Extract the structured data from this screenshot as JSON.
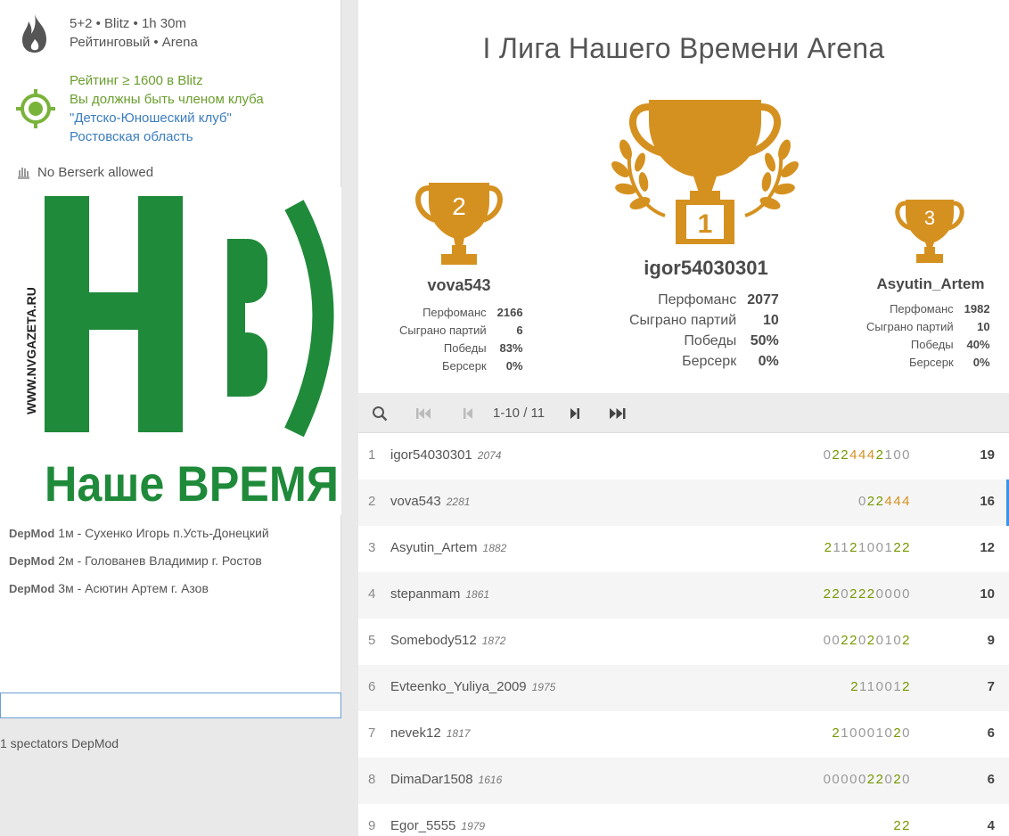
{
  "tournament": {
    "clock_line": "5+2 • Blitz • 1h 30m",
    "rated_line": "Рейтинговый • Arena",
    "conditions": {
      "rating": "Рейтинг ≥ 1600 в Blitz",
      "club_req": "Вы должны быть членом клуба",
      "club_name": "\"Детско-Юношеский клуб\"",
      "region": "Ростовская область"
    },
    "berserk": "No Berserk allowed"
  },
  "logo": {
    "site": "WWW.NVGAZETA.RU",
    "letters": "НВ",
    "name": "Наше ВРЕМЯ"
  },
  "chat": {
    "messages": [
      {
        "user": "DepMod",
        "text": "1м - Сухенко Игорь п.Усть-Донецкий"
      },
      {
        "user": "DepMod",
        "text": "2м - Голованев Владимир г. Ростов"
      },
      {
        "user": "DepMod",
        "text": "3м - Асютин Артем г. Азов"
      }
    ],
    "input_value": ""
  },
  "spectators": "1 spectators DepMod",
  "main": {
    "title": "I Лига Нашего Времени Arena",
    "podium": {
      "first": {
        "place": "1",
        "name": "igor54030301",
        "stats": [
          [
            "Перфоманс",
            "2077"
          ],
          [
            "Сыграно партий",
            "10"
          ],
          [
            "Победы",
            "50%"
          ],
          [
            "Берсерк",
            "0%"
          ]
        ]
      },
      "second": {
        "place": "2",
        "name": "vova543",
        "stats": [
          [
            "Перфоманс",
            "2166"
          ],
          [
            "Сыграно партий",
            "6"
          ],
          [
            "Победы",
            "83%"
          ],
          [
            "Берсерк",
            "0%"
          ]
        ]
      },
      "third": {
        "place": "3",
        "name": "Asyutin_Artem",
        "stats": [
          [
            "Перфоманс",
            "1982"
          ],
          [
            "Сыграно партий",
            "10"
          ],
          [
            "Победы",
            "40%"
          ],
          [
            "Берсерк",
            "0%"
          ]
        ]
      }
    },
    "pager": "1-10 / 11",
    "standings": [
      {
        "rank": "1",
        "name": "igor54030301",
        "rating": "2074",
        "sheet": "0224442100",
        "score": "19"
      },
      {
        "rank": "2",
        "name": "vova543",
        "rating": "2281",
        "sheet": "022444",
        "score": "16"
      },
      {
        "rank": "3",
        "name": "Asyutin_Artem",
        "rating": "1882",
        "sheet": "2112100122",
        "score": "12"
      },
      {
        "rank": "4",
        "name": "stepanmam",
        "rating": "1861",
        "sheet": "2202220000",
        "score": "10"
      },
      {
        "rank": "5",
        "name": "Somebody512",
        "rating": "1872",
        "sheet": "0022020102",
        "score": "9"
      },
      {
        "rank": "6",
        "name": "Evteenko_Yuliya_2009",
        "rating": "1975",
        "sheet": "2110012",
        "score": "7"
      },
      {
        "rank": "7",
        "name": "nevek12",
        "rating": "1817",
        "sheet": "210001020",
        "score": "6"
      },
      {
        "rank": "8",
        "name": "DimaDar1508",
        "rating": "1616",
        "sheet": "0000022020",
        "score": "6"
      },
      {
        "rank": "9",
        "name": "Egor_5555",
        "rating": "1979",
        "sheet": "22",
        "score": "4"
      }
    ]
  },
  "colors": {
    "gold": "#d59120",
    "green": "#759900",
    "link": "#3b7dbf",
    "logo_green": "#1f8a3a"
  }
}
